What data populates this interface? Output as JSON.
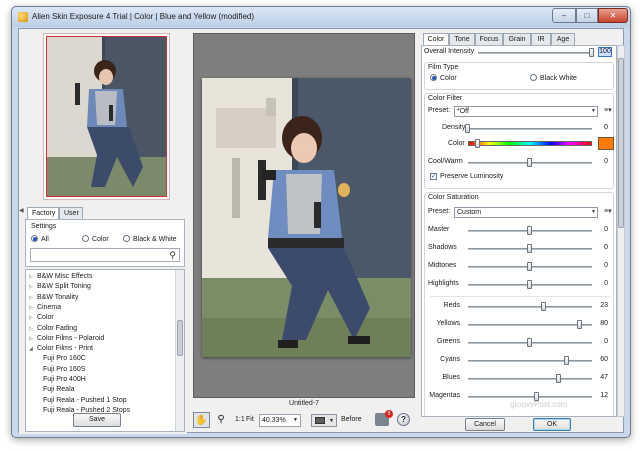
{
  "window": {
    "title": "Alien Skin Exposure 4 Trial | Color | Blue and Yellow (modified)",
    "min_label": "–",
    "max_label": "□",
    "close_label": "✕"
  },
  "left": {
    "tabs": [
      "Factory",
      "User"
    ],
    "settings_label": "Settings",
    "filters": [
      "All",
      "Color",
      "Black & White"
    ],
    "selected_filter": "All",
    "search_placeholder": "",
    "list": [
      {
        "label": "B&W Misc Effects",
        "indent": 0,
        "expander": "▷"
      },
      {
        "label": "B&W Split Toning",
        "indent": 0,
        "expander": "▷"
      },
      {
        "label": "B&W Tonality",
        "indent": 0,
        "expander": "▷"
      },
      {
        "label": "Cinema",
        "indent": 0,
        "expander": "▷"
      },
      {
        "label": "Color",
        "indent": 0,
        "expander": "▷"
      },
      {
        "label": "Color Fading",
        "indent": 0,
        "expander": "▷"
      },
      {
        "label": "Color Films - Polaroid",
        "indent": 0,
        "expander": "▷"
      },
      {
        "label": "Color Films - Print",
        "indent": 0,
        "expander": "◢"
      },
      {
        "label": "Fuji Pro 160C",
        "indent": 1,
        "expander": ""
      },
      {
        "label": "Fuji Pro 160S",
        "indent": 1,
        "expander": ""
      },
      {
        "label": "Fuji Pro 400H",
        "indent": 1,
        "expander": ""
      },
      {
        "label": "Fuji Reala",
        "indent": 1,
        "expander": ""
      },
      {
        "label": "Fuji Reala - Pushed 1 Stop",
        "indent": 1,
        "expander": ""
      },
      {
        "label": "Fuji Reala - Pushed 2 Stops",
        "indent": 1,
        "expander": ""
      }
    ],
    "save_label": "Save"
  },
  "center": {
    "document_name": "Untitled-7",
    "zoom_one_to_one": "1:1",
    "zoom_fit": "Fit",
    "zoom_value": "40.33%",
    "before_label": "Before",
    "notification_count": "9",
    "help_label": "?"
  },
  "right": {
    "tabs": [
      "Color",
      "Tone",
      "Focus",
      "Grain",
      "IR",
      "Age"
    ],
    "active_tab": "Color",
    "overall_intensity": {
      "label": "Overall Intensity",
      "value": "100",
      "fraction": 1.0
    },
    "film_type": {
      "label": "Film Type",
      "options": [
        "Color",
        "Black  White"
      ],
      "selected": "Color"
    },
    "color_filter": {
      "label": "Color Filter",
      "preset_label": "Preset:",
      "preset_value": "*Off",
      "density": {
        "label": "Density",
        "value": "0",
        "fraction": 0.0
      },
      "color": {
        "label": "Color",
        "fraction": 0.08,
        "swatch": "#ff7a00"
      },
      "cool_warm": {
        "label": "Cool/Warm",
        "value": "0",
        "fraction": 0.5
      },
      "preserve_luminosity": {
        "label": "Preserve Luminosity",
        "checked": true
      }
    },
    "color_saturation": {
      "label": "Color Saturation",
      "preset_label": "Preset:",
      "preset_value": "Custom",
      "sliders": [
        {
          "label": "Master",
          "value": "0",
          "fraction": 0.5
        },
        {
          "label": "Shadows",
          "value": "0",
          "fraction": 0.5
        },
        {
          "label": "Midtones",
          "value": "0",
          "fraction": 0.5
        },
        {
          "label": "Highlights",
          "value": "0",
          "fraction": 0.5
        }
      ],
      "color_sliders": [
        {
          "label": "Reds",
          "value": "23",
          "fraction": 0.61
        },
        {
          "label": "Yellows",
          "value": "80",
          "fraction": 0.9
        },
        {
          "label": "Greens",
          "value": "0",
          "fraction": 0.5
        },
        {
          "label": "Cyans",
          "value": "60",
          "fraction": 0.8
        },
        {
          "label": "Blues",
          "value": "47",
          "fraction": 0.73
        },
        {
          "label": "Magentas",
          "value": "12",
          "fraction": 0.56
        }
      ]
    },
    "cancel_label": "Cancel",
    "ok_label": "OK"
  },
  "watermark": "groovyPost.com"
}
